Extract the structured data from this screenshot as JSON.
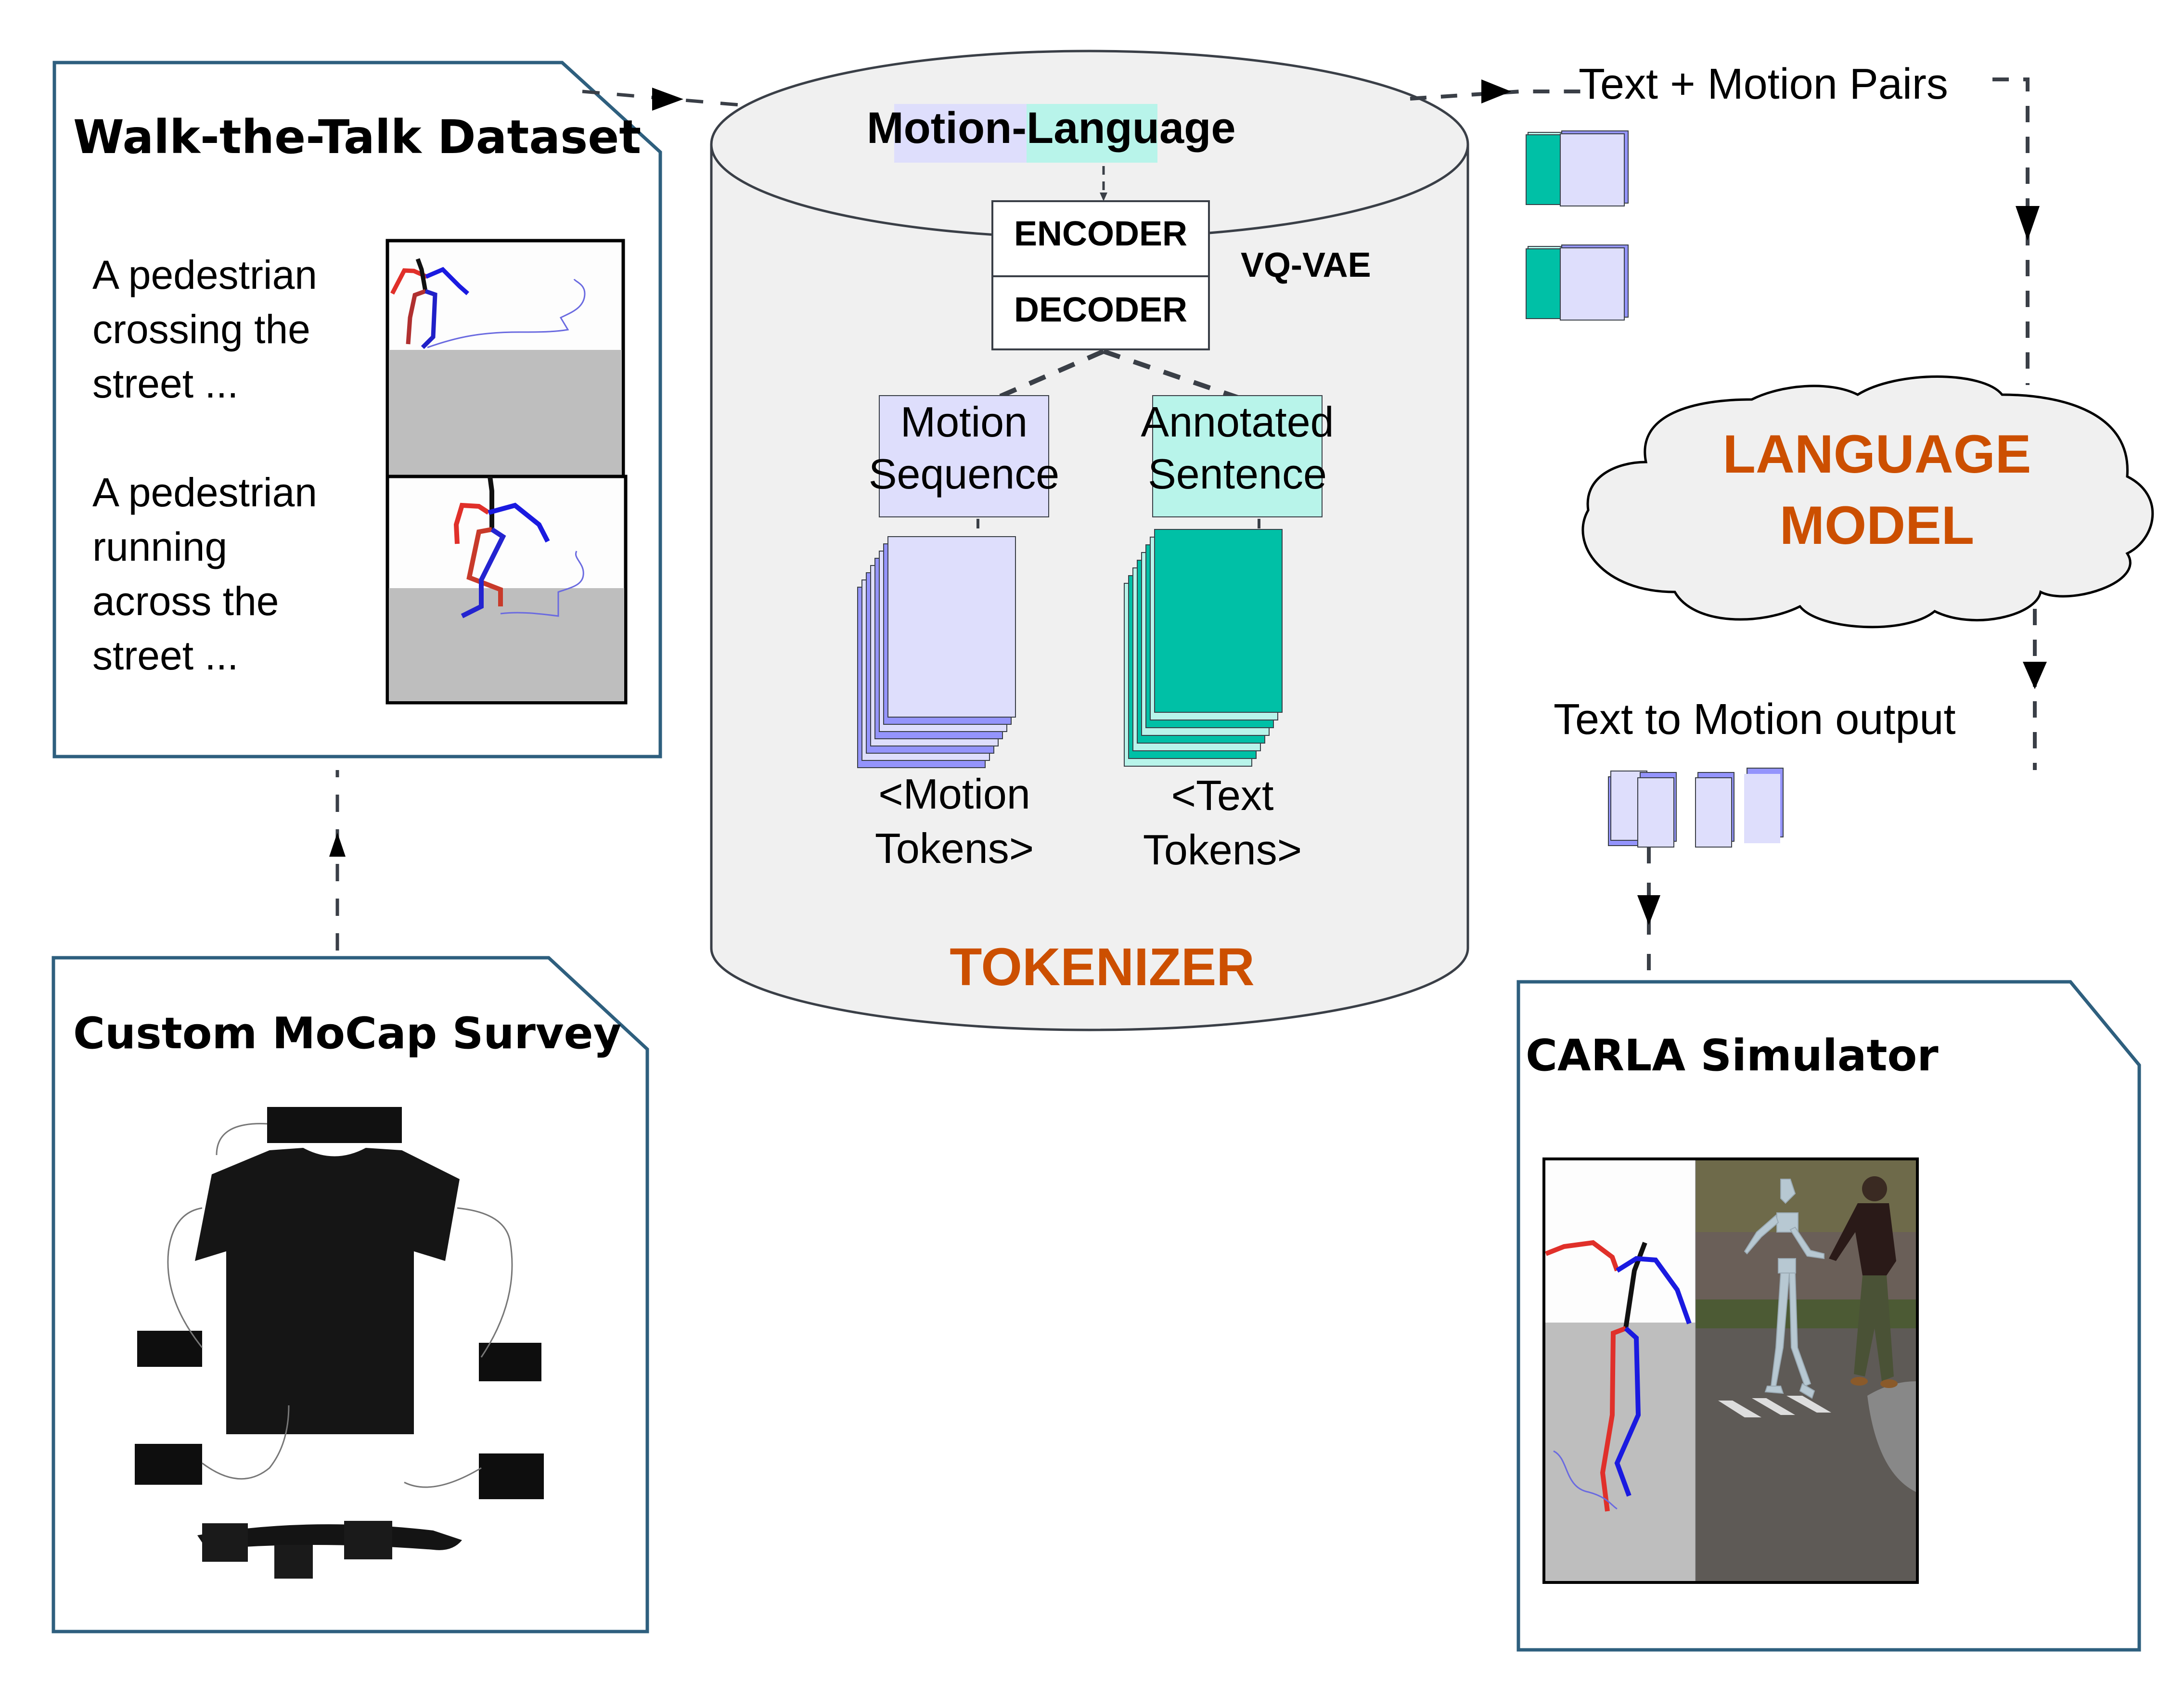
{
  "colors": {
    "panel_border": "#2e5f7e",
    "arrow": "#3a3f47",
    "cylinder_fill": "#f0f0f0",
    "lavender": "#dedefc",
    "lavender_dark": "#9494fc",
    "mint": "#b8f4ea",
    "teal": "#00c0a6",
    "orange": "#cc4f00"
  },
  "dataset_panel": {
    "title": "Walk-the-Talk Dataset",
    "examples": [
      {
        "lines": [
          "A pedestrian",
          "crossing the",
          "street ..."
        ]
      },
      {
        "lines": [
          "A pedestrian",
          "running",
          "across the",
          "street ..."
        ]
      }
    ]
  },
  "mocap_panel": {
    "title": "Custom MoCap Survey"
  },
  "tokenizer": {
    "header_left": "Motion-",
    "header_right": "Language",
    "encoder_label": "ENCODER",
    "decoder_label": "DECODER",
    "vqvae_label": "VQ-VAE",
    "motion_sequence": [
      "Motion",
      "Sequence"
    ],
    "annotated_sentence": [
      "Annotated",
      "Sentence"
    ],
    "motion_tokens": [
      "<Motion",
      "Tokens>"
    ],
    "text_tokens": [
      "<Text",
      "Tokens>"
    ],
    "title": "TOKENIZER"
  },
  "pairs": {
    "label": "Text + Motion Pairs"
  },
  "language_model": {
    "lines": [
      "LANGUAGE",
      "MODEL"
    ]
  },
  "output": {
    "label": "Text to Motion output"
  },
  "carla_panel": {
    "title": "CARLA Simulator"
  }
}
